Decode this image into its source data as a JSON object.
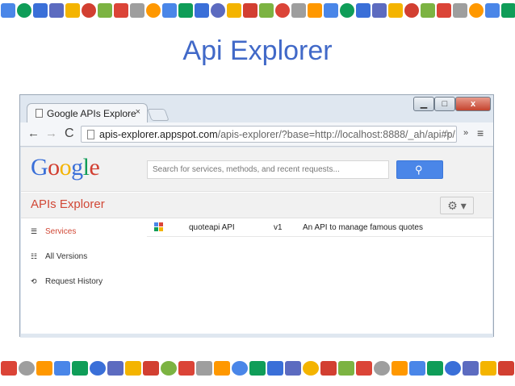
{
  "slide": {
    "title": "Api Explorer"
  },
  "browser": {
    "tab_title": "Google APIs Explore",
    "tab_close": "×",
    "url_host": "apis-explorer.appspot.com",
    "url_path": "/apis-explorer/?base=http://localhost:8888/_ah/api#p/",
    "window_min": "▁",
    "window_max": "□",
    "window_close": "x",
    "back_glyph": "←",
    "forward_glyph": "→",
    "reload_glyph": "C",
    "star_glyph": "☆",
    "ext_glyph": "»",
    "menu_glyph": "≡"
  },
  "page": {
    "logo": [
      "G",
      "o",
      "o",
      "g",
      "l",
      "e"
    ],
    "logo_colors": [
      "#3a6fd8",
      "#d23f31",
      "#f4b400",
      "#3a6fd8",
      "#0f9d58",
      "#d23f31"
    ],
    "search_placeholder": "Search for services, methods, and recent requests...",
    "search_button_icon": "search-icon",
    "apis_title": "APIs Explorer",
    "settings_label": "⚙ ▾"
  },
  "sidebar": {
    "items": [
      {
        "label": "Services",
        "icon": "list-icon",
        "glyph": "☰",
        "active": true
      },
      {
        "label": "All Versions",
        "icon": "versions-icon",
        "glyph": "☷",
        "active": false
      },
      {
        "label": "Request History",
        "icon": "history-icon",
        "glyph": "⟲",
        "active": false
      }
    ]
  },
  "services": [
    {
      "name": "quoteapi API",
      "version": "v1",
      "description": "An API to manage famous quotes"
    }
  ],
  "colors": {
    "accent_red": "#d14836",
    "search_blue": "#4a86e8",
    "slide_title": "#4169c8",
    "strip": [
      "#4a86e8",
      "#db4437",
      "#f4b400",
      "#0f9d58",
      "#9e9e9e",
      "#d23f31",
      "#3a6fd8",
      "#ff9800",
      "#7cb342",
      "#5c6bc0"
    ]
  }
}
